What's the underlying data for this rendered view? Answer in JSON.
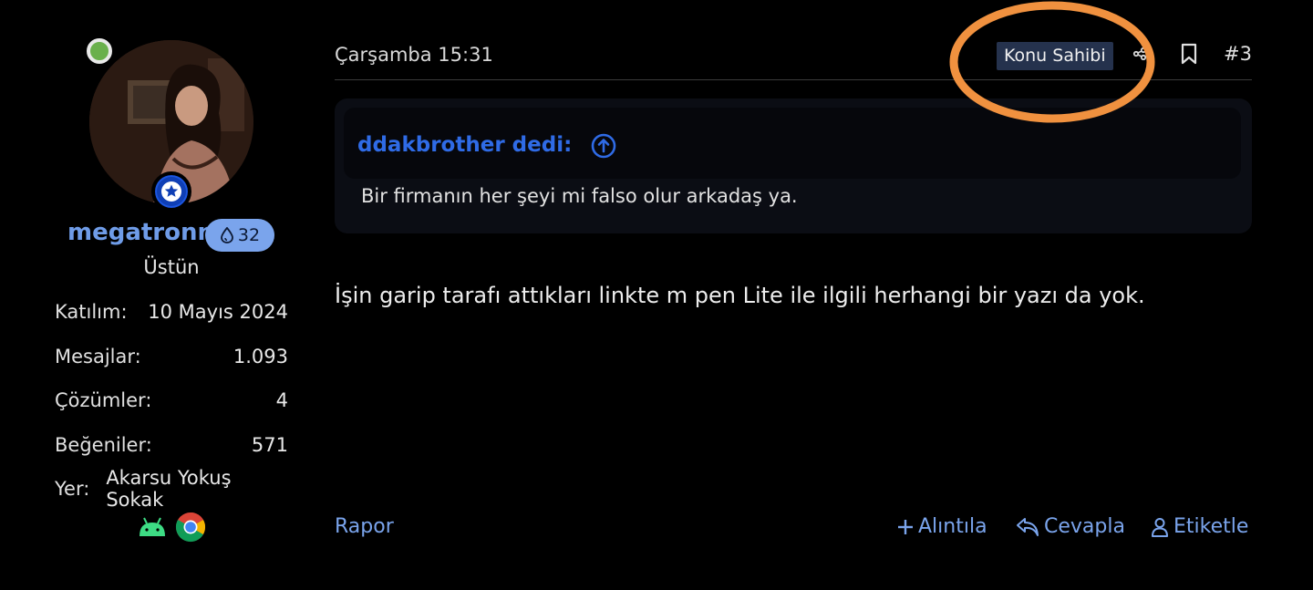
{
  "user": {
    "name": "megatronn",
    "points": "32",
    "title": "Üstün",
    "stats": [
      {
        "label": "Katılım:",
        "value": "10 Mayıs 2024"
      },
      {
        "label": "Mesajlar:",
        "value": "1.093"
      },
      {
        "label": "Çözümler:",
        "value": "4"
      },
      {
        "label": "Beğeniler:",
        "value": "571"
      },
      {
        "label": "Yer:",
        "value": "Akarsu Yokuş Sokak"
      }
    ],
    "online": true
  },
  "post": {
    "date": "Çarşamba 15:31",
    "op_badge": "Konu Sahibi",
    "number": "#3",
    "quote": {
      "author": "ddakbrother dedi:",
      "text": "Bir firmanın her şeyi mi falso olur arkadaş ya."
    },
    "body": "İşin garip tarafı attıkları linkte m pen Lite ile ilgili herhangi bir yazı da yok."
  },
  "actions": {
    "report": "Rapor",
    "quote": "Alıntıla",
    "reply": "Cevapla",
    "tag": "Etiketle"
  },
  "colors": {
    "background": "#000000",
    "link": "#7aa4ec",
    "quote_author": "#2f6be6",
    "highlight": "#f0913f",
    "op_badge_bg": "#25324d"
  },
  "icons": [
    "online-status-icon",
    "star-rank-icon",
    "drop-icon",
    "share-icon",
    "bookmark-icon",
    "arrow-up-circle-icon",
    "plus-icon",
    "reply-icon",
    "user-icon",
    "android-icon",
    "chrome-icon"
  ]
}
